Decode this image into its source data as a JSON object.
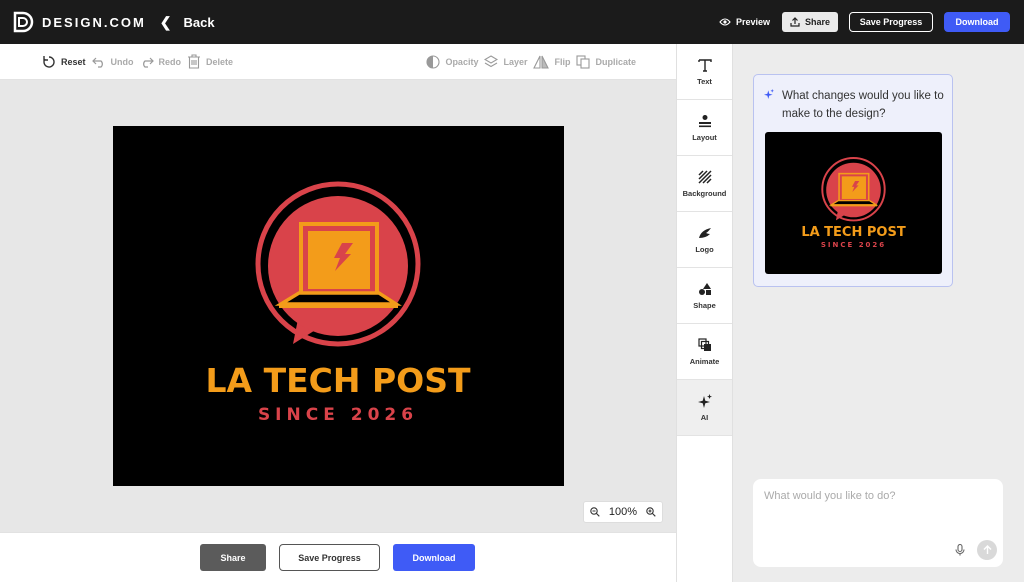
{
  "header": {
    "brand": "DESIGN.COM",
    "back_label": "Back",
    "preview_label": "Preview",
    "share_label": "Share",
    "save_label": "Save Progress",
    "download_label": "Download"
  },
  "toolbar": {
    "left": [
      {
        "label": "Reset",
        "icon": "reset-icon",
        "active": true
      },
      {
        "label": "Undo",
        "icon": "undo-icon",
        "active": false
      },
      {
        "label": "Redo",
        "icon": "redo-icon",
        "active": false
      },
      {
        "label": "Delete",
        "icon": "trash-icon",
        "active": false
      }
    ],
    "right": [
      {
        "label": "Opacity",
        "icon": "opacity-icon"
      },
      {
        "label": "Layer",
        "icon": "layers-icon"
      },
      {
        "label": "Flip",
        "icon": "flip-icon"
      },
      {
        "label": "Duplicate",
        "icon": "duplicate-icon"
      }
    ]
  },
  "design": {
    "title": "LA TECH POST",
    "subtitle": "SINCE 2026",
    "colors": {
      "background": "#000000",
      "accent": "#f39c1a",
      "red": "#d9434a"
    }
  },
  "zoom": {
    "level": "100%"
  },
  "bottom": {
    "share_label": "Share",
    "save_label": "Save Progress",
    "download_label": "Download"
  },
  "sidemenu": {
    "items": [
      {
        "label": "Text",
        "icon": "text-icon"
      },
      {
        "label": "Layout",
        "icon": "layout-icon"
      },
      {
        "label": "Background",
        "icon": "background-icon"
      },
      {
        "label": "Logo",
        "icon": "logo-icon"
      },
      {
        "label": "Shape",
        "icon": "shape-icon"
      },
      {
        "label": "Animate",
        "icon": "animate-icon"
      },
      {
        "label": "AI",
        "icon": "sparkle-icon"
      }
    ]
  },
  "ai": {
    "question": "What changes would you like to make to the design?",
    "thumb_title": "LA TECH POST",
    "thumb_subtitle": "SINCE 2026",
    "input_placeholder": "What would you like to do?"
  }
}
